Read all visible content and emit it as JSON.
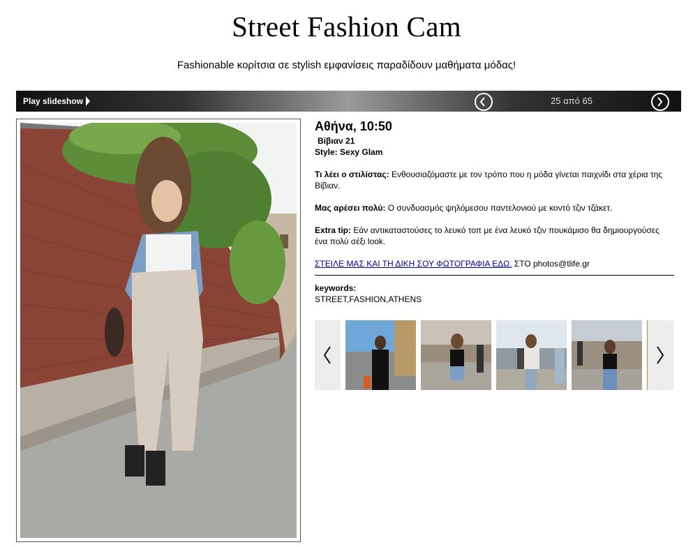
{
  "header": {
    "title": "Street Fashion Cam",
    "subtitle": "Fashionable κορίτσια σε stylish εμφανίσεις παραδίδουν μαθήματα μόδας!"
  },
  "slideshow_bar": {
    "play_label": "Play slideshow",
    "counter": "25 από 65"
  },
  "details": {
    "location_time": "Αθήνα, 10:50",
    "name": "Βίβιαν 21",
    "style": "Style: Sexy Glam",
    "stylist_label": "Τι λέει ο στιλίστας:",
    "stylist_text": " Ενθουσιαζόμαστε με τον τρόπο που η μόδα γίνεται παιχνίδι στα χέρια της Βίβιαν.",
    "likes_label": "Μας αρέσει πολύ:",
    "likes_text": " Ο συνδυασμός ψηλόμεσου παντελονιού με κοντό τζιν τζάκετ.",
    "tip_label": "Extra tip:",
    "tip_text": " Εάν αντικαταστούσες το λευκό τοπ με ένα λευκό τζιν πουκάμισο θα δημιουργούσες ένα πολύ σέξι look.",
    "send_link": "ΣΤΕΙΛΕ ΜΑΣ ΚΑΙ ΤΗ ΔΙΚΗ ΣΟΥ ΦΩΤΟΓΡΑΦΙΑ ΕΔΩ.",
    "send_text": " ΣΤΟ photos@tlife.gr",
    "keywords_label": "keywords:",
    "keywords": "STREET,FASHION,ATHENS"
  },
  "thumbnails_count": 4,
  "colors": {
    "link": "#000099",
    "bar_dark": "#111111",
    "bar_light": "#9a9a9a"
  }
}
